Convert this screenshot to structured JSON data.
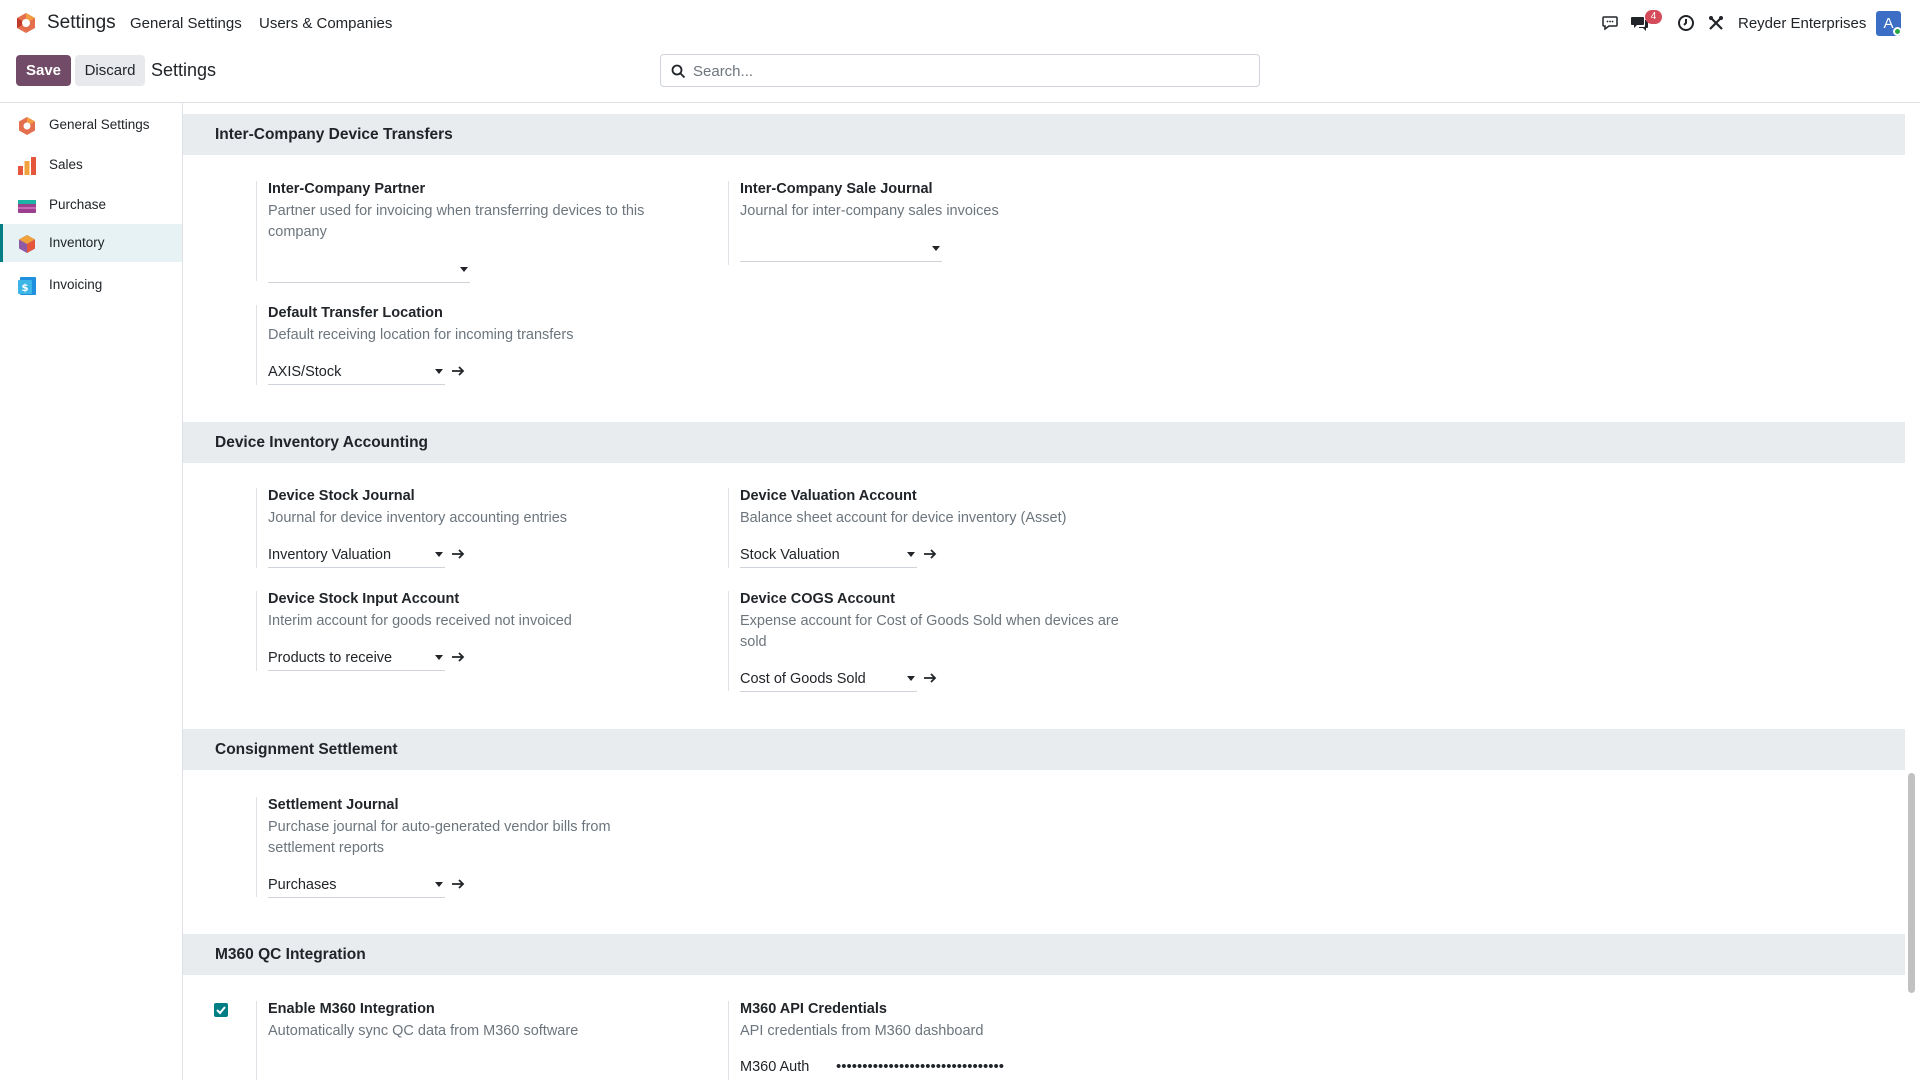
{
  "topbar": {
    "app_name": "Settings",
    "menu": [
      "General Settings",
      "Users & Companies"
    ],
    "notification_count": "4",
    "company": "Reyder Enterprises",
    "avatar_initial": "A"
  },
  "control_panel": {
    "save_label": "Save",
    "discard_label": "Discard",
    "title": "Settings",
    "search_placeholder": "Search..."
  },
  "sidebar": {
    "items": [
      {
        "label": "General Settings",
        "icon": "odoo-logo-icon",
        "active": false
      },
      {
        "label": "Sales",
        "icon": "sales-chart-icon",
        "active": false
      },
      {
        "label": "Purchase",
        "icon": "purchase-card-icon",
        "active": false
      },
      {
        "label": "Inventory",
        "icon": "inventory-box-icon",
        "active": true
      },
      {
        "label": "Invoicing",
        "icon": "invoicing-dollar-icon",
        "active": false
      }
    ]
  },
  "sections": {
    "transfers": {
      "title": "Inter-Company Device Transfers",
      "partner": {
        "title": "Inter-Company Partner",
        "desc": "Partner used for invoicing when transferring devices to this company",
        "value": ""
      },
      "sale_journal": {
        "title": "Inter-Company Sale Journal",
        "desc": "Journal for inter-company sales invoices",
        "value": ""
      },
      "location": {
        "title": "Default Transfer Location",
        "desc": "Default receiving location for incoming transfers",
        "value": "AXIS/Stock"
      }
    },
    "accounting": {
      "title": "Device Inventory Accounting",
      "stock_journal": {
        "title": "Device Stock Journal",
        "desc": "Journal for device inventory accounting entries",
        "value": "Inventory Valuation"
      },
      "valuation_account": {
        "title": "Device Valuation Account",
        "desc": "Balance sheet account for device inventory (Asset)",
        "value": "Stock Valuation"
      },
      "input_account": {
        "title": "Device Stock Input Account",
        "desc": "Interim account for goods received not invoiced",
        "value": "Products to receive"
      },
      "cogs_account": {
        "title": "Device COGS Account",
        "desc": "Expense account for Cost of Goods Sold when devices are sold",
        "value": "Cost of Goods Sold"
      }
    },
    "consignment": {
      "title": "Consignment Settlement",
      "journal": {
        "title": "Settlement Journal",
        "desc": "Purchase journal for auto-generated vendor bills from settlement reports",
        "value": "Purchases"
      }
    },
    "m360": {
      "title": "M360 QC Integration",
      "enable": {
        "title": "Enable M360 Integration",
        "desc": "Automatically sync QC data from M360 software",
        "checked": true
      },
      "credentials": {
        "title": "M360 API Credentials",
        "desc": "API credentials from M360 dashboard",
        "auth_label": "M360 Auth",
        "auth_value": "••••••••••••••••••••••••••••••••"
      }
    }
  },
  "colors": {
    "brand": "#714b67",
    "accent": "#017e84",
    "badge": "#d44c59"
  }
}
